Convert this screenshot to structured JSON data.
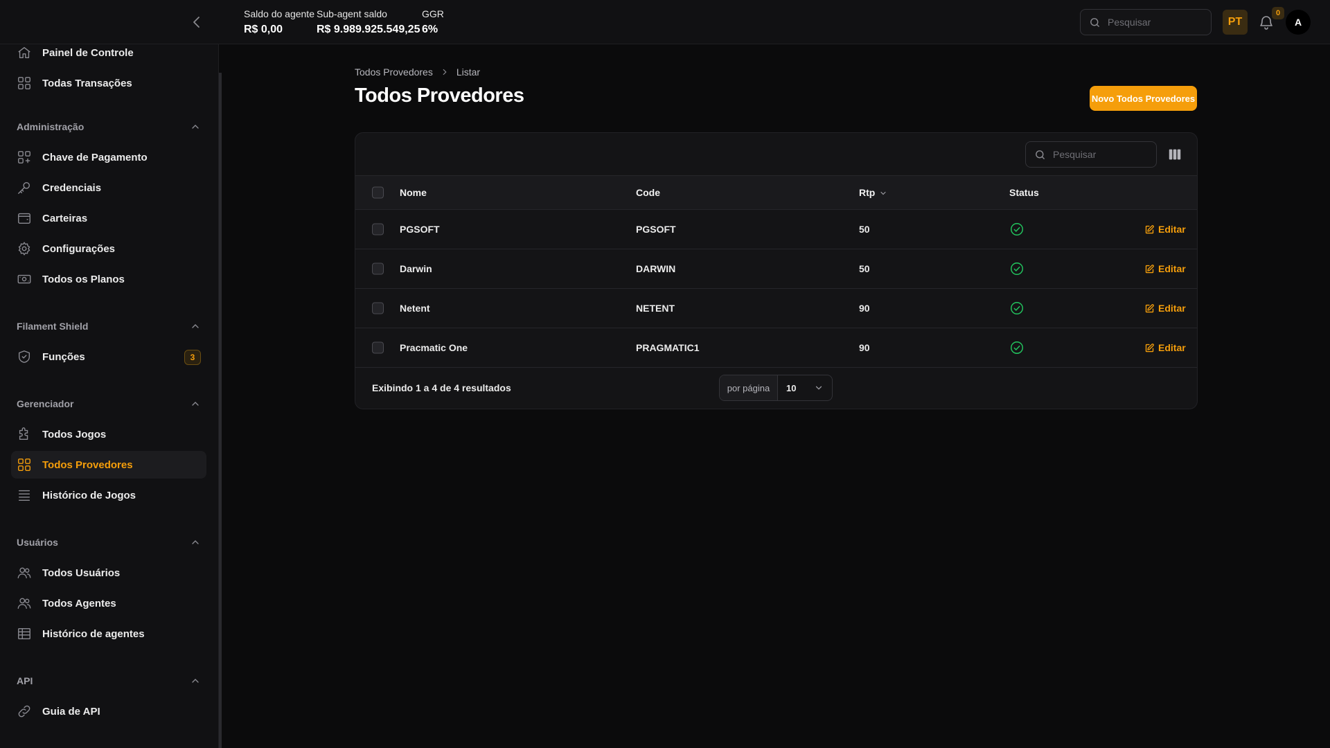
{
  "topbar": {
    "balances": [
      {
        "label": "Saldo do agente",
        "value": "R$ 0,00"
      },
      {
        "label": "Sub-agent saldo",
        "value": "R$ 9.989.925.549,25"
      },
      {
        "label": "GGR",
        "value": "6%"
      }
    ],
    "search_placeholder": "Pesquisar",
    "language": "PT",
    "notification_count": "0",
    "avatar_initial": "A"
  },
  "sidebar": {
    "top_items": [
      {
        "label": "Painel de Controle",
        "icon": "home-icon"
      },
      {
        "label": "Todas Transações",
        "icon": "grid-icon"
      }
    ],
    "groups": [
      {
        "title": "Administração",
        "items": [
          {
            "label": "Chave de Pagamento",
            "icon": "grid-plus-icon"
          },
          {
            "label": "Credenciais",
            "icon": "key-icon"
          },
          {
            "label": "Carteiras",
            "icon": "wallet-icon"
          },
          {
            "label": "Configurações",
            "icon": "gear-icon"
          },
          {
            "label": "Todos os Planos",
            "icon": "money-icon"
          }
        ]
      },
      {
        "title": "Filament Shield",
        "items": [
          {
            "label": "Funções",
            "icon": "shield-icon",
            "badge": "3"
          }
        ]
      },
      {
        "title": "Gerenciador",
        "items": [
          {
            "label": "Todos Jogos",
            "icon": "puzzle-icon"
          },
          {
            "label": "Todos Provedores",
            "icon": "grid-icon",
            "active": true
          },
          {
            "label": "Histórico de Jogos",
            "icon": "list-icon"
          }
        ]
      },
      {
        "title": "Usuários",
        "items": [
          {
            "label": "Todos Usuários",
            "icon": "users-icon"
          },
          {
            "label": "Todos Agentes",
            "icon": "users-icon"
          },
          {
            "label": "Histórico de agentes",
            "icon": "table-icon"
          }
        ]
      },
      {
        "title": "API",
        "items": [
          {
            "label": "Guia de API",
            "icon": "link-icon"
          }
        ]
      }
    ]
  },
  "main": {
    "breadcrumb": [
      "Todos Provedores",
      "Listar"
    ],
    "title": "Todos Provedores",
    "new_button": "Novo Todos Provedores",
    "table": {
      "search_placeholder": "Pesquisar",
      "columns": {
        "name": "Nome",
        "code": "Code",
        "rtp": "Rtp",
        "status": "Status"
      },
      "rows": [
        {
          "name": "PGSOFT",
          "code": "PGSOFT",
          "rtp": "50",
          "status": "active"
        },
        {
          "name": "Darwin",
          "code": "DARWIN",
          "rtp": "50",
          "status": "active"
        },
        {
          "name": "Netent",
          "code": "NETENT",
          "rtp": "90",
          "status": "active"
        },
        {
          "name": "Pracmatic One",
          "code": "PRAGMATIC1",
          "rtp": "90",
          "status": "active"
        }
      ],
      "edit_label": "Editar",
      "footer_text": "Exibindo 1 a 4 de 4 resultados",
      "per_page_label": "por página",
      "per_page_value": "10"
    }
  },
  "colors": {
    "accent": "#f59e0b",
    "success": "#22c55e",
    "background": "#0b0b0c",
    "panel": "#111113"
  }
}
